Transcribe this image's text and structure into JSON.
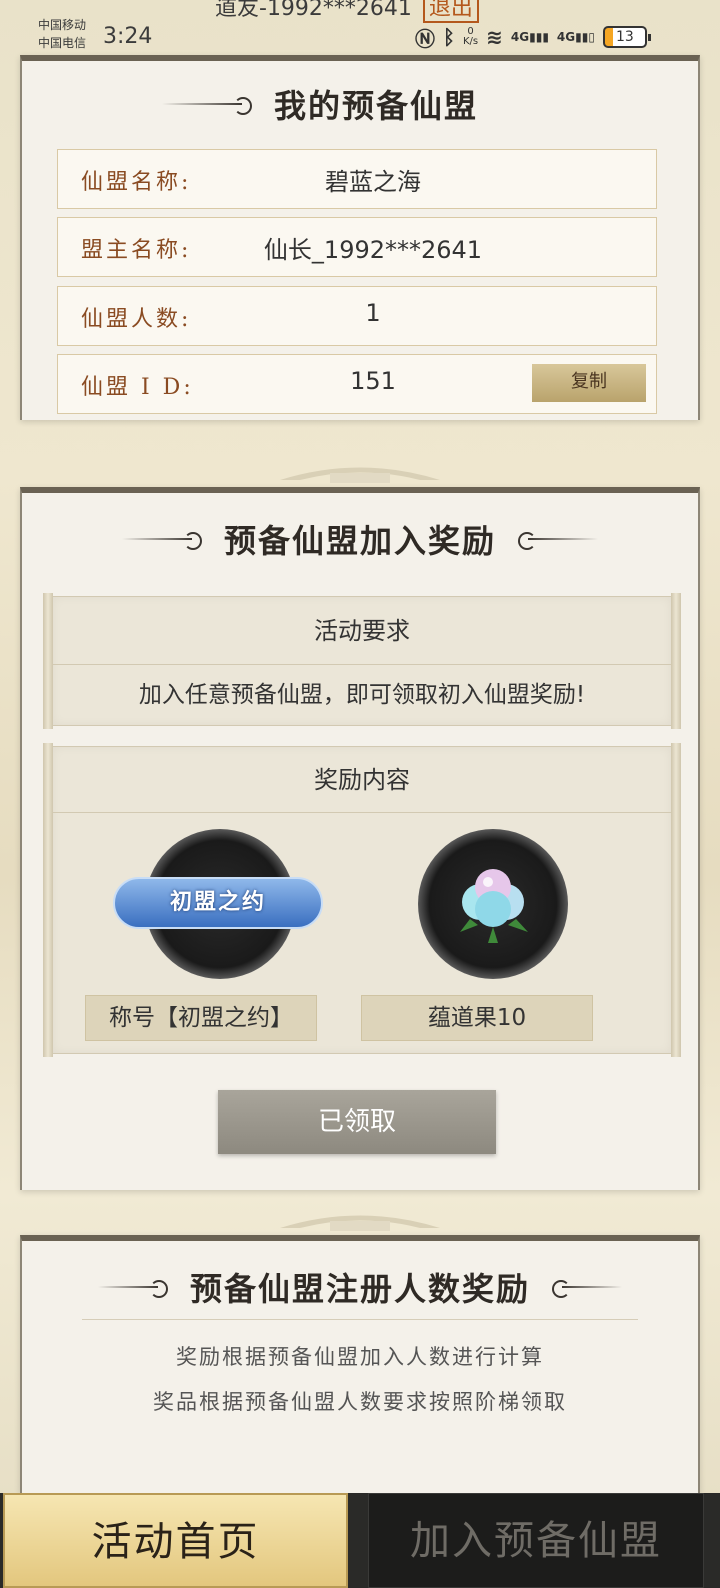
{
  "status_bar": {
    "carrier_1": "中国移动",
    "carrier_2": "中国电信",
    "time": "3:24",
    "account_text": "道友-1992***2641",
    "logout_label": "退出",
    "net_speed_value": "0",
    "net_speed_unit": "K/s",
    "signal_1": "4G",
    "signal_2": "4G",
    "battery": "13"
  },
  "my_alliance": {
    "title": "我的预备仙盟",
    "rows": [
      {
        "label": "仙盟名称:",
        "value": "碧蓝之海"
      },
      {
        "label": "盟主名称:",
        "value": "仙长_1992***2641"
      },
      {
        "label": "仙盟人数:",
        "value": "1"
      },
      {
        "label": "仙盟 I D:",
        "value": "151"
      }
    ],
    "copy_label": "复制"
  },
  "join_reward": {
    "title": "预备仙盟加入奖励",
    "requirement_head": "活动要求",
    "requirement_text": "加入任意预备仙盟，即可领取初入仙盟奖励!",
    "reward_head": "奖励内容",
    "badge_text": "初盟之约",
    "rewards": [
      "称号【初盟之约】",
      "蕴道果10"
    ],
    "claimed_label": "已领取"
  },
  "register_reward": {
    "title": "预备仙盟注册人数奖励",
    "line_1": "奖励根据预备仙盟加入人数进行计算",
    "line_2": "奖品根据预备仙盟人数要求按照阶梯领取"
  },
  "tabs": {
    "home": "活动首页",
    "join": "加入预备仙盟"
  },
  "colors": {
    "accent_gold": "#e3c77e",
    "label_brown": "#8a4b22",
    "dark_bar": "#2a2a28"
  }
}
